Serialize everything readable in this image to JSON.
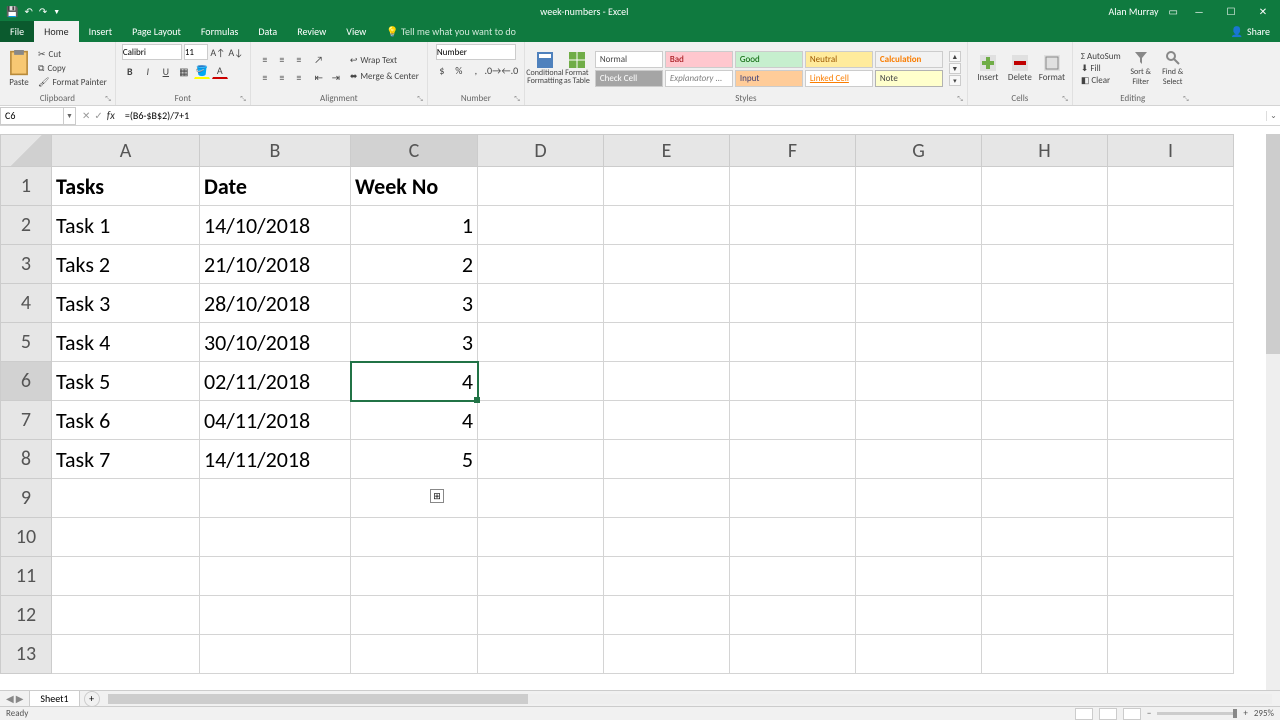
{
  "title": {
    "doc": "week-numbers",
    "app": "Excel",
    "user": "Alan Murray"
  },
  "qat": {
    "save": "💾",
    "undo": "↶",
    "redo": "↷"
  },
  "tabs": [
    "File",
    "Home",
    "Insert",
    "Page Layout",
    "Formulas",
    "Data",
    "Review",
    "View"
  ],
  "tellme": "Tell me what you want to do",
  "share": "Share",
  "ribbon": {
    "clipboard": {
      "label": "Clipboard",
      "paste": "Paste",
      "cut": "Cut",
      "copy": "Copy",
      "painter": "Format Painter"
    },
    "font": {
      "label": "Font",
      "name": "Calibri",
      "size": "11"
    },
    "alignment": {
      "label": "Alignment",
      "wrap": "Wrap Text",
      "merge": "Merge & Center"
    },
    "number": {
      "label": "Number",
      "fmt": "Number"
    },
    "styles": {
      "label": "Styles",
      "cond": "Conditional Formatting",
      "table": "Format as Table",
      "list": [
        "Normal",
        "Bad",
        "Good",
        "Neutral",
        "Calculation",
        "Check Cell",
        "Explanatory ...",
        "Input",
        "Linked Cell",
        "Note"
      ]
    },
    "cells": {
      "label": "Cells",
      "insert": "Insert",
      "delete": "Delete",
      "format": "Format"
    },
    "editing": {
      "label": "Editing",
      "sum": "AutoSum",
      "fill": "Fill",
      "clear": "Clear",
      "sort": "Sort & Filter",
      "find": "Find & Select"
    }
  },
  "namebox": "C6",
  "formula": "=(B6-$B$2)/7+1",
  "columns": [
    "A",
    "B",
    "C",
    "D",
    "E",
    "F",
    "G",
    "H",
    "I"
  ],
  "col_widths": {
    "A": 148,
    "B": 151,
    "C": 127,
    "D": 126,
    "E": 126,
    "F": 126,
    "G": 126,
    "H": 126,
    "I": 126
  },
  "rows": [
    1,
    2,
    3,
    4,
    5,
    6,
    7,
    8,
    9,
    10,
    11,
    12,
    13
  ],
  "headers": {
    "A": "Tasks",
    "B": "Date",
    "C": "Week No"
  },
  "data": [
    {
      "task": "Task 1",
      "date": "14/10/2018",
      "week": "1"
    },
    {
      "task": "Taks 2",
      "date": "21/10/2018",
      "week": "2"
    },
    {
      "task": "Task 3",
      "date": "28/10/2018",
      "week": "3"
    },
    {
      "task": "Task 4",
      "date": "30/10/2018",
      "week": "3"
    },
    {
      "task": "Task 5",
      "date": "02/11/2018",
      "week": "4"
    },
    {
      "task": "Task 6",
      "date": "04/11/2018",
      "week": "4"
    },
    {
      "task": "Task 7",
      "date": "14/11/2018",
      "week": "5"
    }
  ],
  "selected": {
    "row": 6,
    "col": "C"
  },
  "sheet": "Sheet1",
  "status": "Ready",
  "zoom": "295%"
}
